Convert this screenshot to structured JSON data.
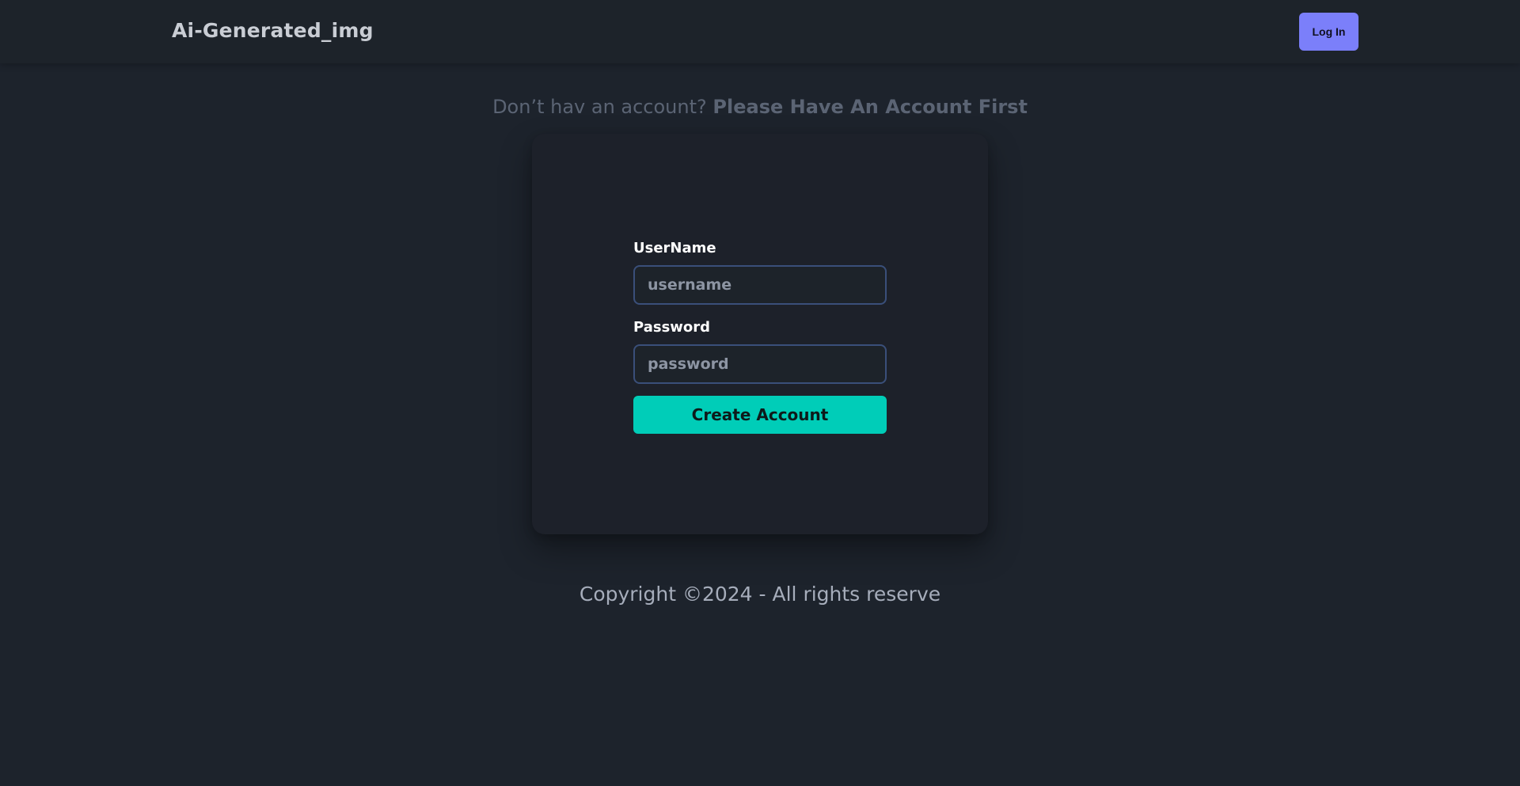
{
  "navbar": {
    "brand": "Ai-Generated_img",
    "login_label": "Log In"
  },
  "prompt": {
    "text": "Don’t hav an account?",
    "link": "Please Have An Account First"
  },
  "form": {
    "username_label": "UserName",
    "username_placeholder": "username",
    "password_label": "Password",
    "password_placeholder": "password",
    "submit_label": "Create Account"
  },
  "footer": {
    "copyright": "Copyright ©2024 - All rights reserve"
  },
  "colors": {
    "background": "#1d232c",
    "login_button": "#7b7ffa",
    "create_button": "#00cdb8",
    "input_border": "#3a4f7a"
  }
}
